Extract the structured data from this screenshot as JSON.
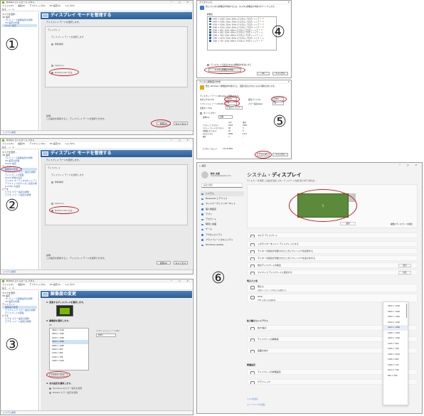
{
  "labels": {
    "one": "①",
    "two": "②",
    "three": "③",
    "four": "④",
    "five": "⑤",
    "six": "⑥"
  },
  "nvidia": {
    "window_title": "NVIDIA コントロール パネル",
    "menu": [
      "ファイル(F)",
      "編集(E)",
      "デスクトップ(K)",
      "3D 設定(3)",
      "ヘルプ(H)"
    ],
    "toolbar": [
      "戻る",
      "→",
      "⌂"
    ],
    "tree": [
      {
        "text": "タスクを選択...",
        "kind": "cat"
      },
      {
        "text": "3D 設定",
        "kind": "cat"
      },
      {
        "text": "プレビューで画像設定を調整",
        "kind": "item"
      },
      {
        "text": "3D 設定の管理",
        "kind": "item"
      },
      {
        "text": "PhysX 設定",
        "kind": "item"
      },
      {
        "text": "ディスプレイ",
        "kind": "cat"
      },
      {
        "text": "解像度の変更",
        "kind": "item"
      },
      {
        "text": "デスクトップ カラー設定の調整",
        "kind": "item"
      },
      {
        "text": "ディスプレイの回転",
        "kind": "item"
      },
      {
        "text": "HDCP 状態の表示",
        "kind": "item"
      },
      {
        "text": "デジタル オーディオのセットアップ",
        "kind": "item"
      },
      {
        "text": "デスクトップのサイズと位置の調整",
        "kind": "item"
      },
      {
        "text": "G-SYNC の設定",
        "kind": "item"
      },
      {
        "text": "ビデオ",
        "kind": "cat"
      },
      {
        "text": "ビデオ カラー設定の調整",
        "kind": "item"
      },
      {
        "text": "ビデオ イメージ設定の調整",
        "kind": "item"
      }
    ],
    "header_manage": "ディスプレイ モードを管理する",
    "header_resolution": "解像度の変更",
    "sub_manage": "ディスプレイ モードを選択します。",
    "group_title": "ディスプレイ",
    "opt_prompt": "ディスプレイ モードを選択します",
    "opt_a": "単体構成",
    "opt_b": "Optimus",
    "opt_c": "NVIDIA GPU のみ",
    "desc_label": "説明:",
    "desc_text": "この設定を使用すると、ディスプレイ モードを選択できます。",
    "apply": "適用(A)",
    "cancel": "キャンセル",
    "status": "システム情報",
    "res_step1": "1. 変更するディスプレイを選択します。",
    "res_step2": "2. 解像度を選択します。",
    "res_step3": "3. 次の設定を適用します。",
    "res_refresh_label": "リフレッシュ レート(R):",
    "res_refresh_value": "60Hz",
    "res_group": "PC",
    "res_values": [
      "3840 × 2160",
      "2560 × 1440",
      "1920 × 1200",
      "1920 × 1080",
      "1680 × 1050",
      "1600 × 900",
      "1440 × 900",
      "1366 × 768",
      "1280 × 1024"
    ],
    "res_custom": "カスタマイズ(C)...",
    "res_color_a": "Windows のカラー設定を使用",
    "res_color_b": "NVIDIA カラー設定を使用"
  },
  "dialog4": {
    "title": "カスタマイズ",
    "heading": "新しいカスタム解像度を作成するには、[カスタム解像度の作成] をクリックします。",
    "list_label": "解像度:",
    "rows": [
      "1920 × 1080, 32bit, 60Hz (カスタム) プログレッシブ",
      "1920 × 1080, 32bit, 59Hz (カスタム) プログレッシブ",
      "1920 × 1080, 32bit, 50Hz (カスタム) プログレッシブ",
      "1680 × 1050, 32bit, 60Hz (カスタム) プログレッシブ",
      "1600 × 900, 32bit, 60Hz (カスタム) プログレッシブ",
      "1440 × 900, 32bit, 60Hz (カスタム) プログレッシブ",
      "1366 × 768, 32bit, 60Hz (カスタム) プログレッシブ",
      "1280 × 1024, 32bit, 60Hz (カスタム) プログレッシブ",
      "1280 × 720, 32bit, 60Hz (カスタム) プログレッシブ"
    ],
    "enable_note": "ディスプレイで表示されない解像度を有効にする",
    "create_button": "カスタム解像度の作成...",
    "ok": "OK",
    "cancel": "キャンセル"
  },
  "dialog5": {
    "title": "カスタム解像度の作成",
    "warning": "警告: Windows で解像度を作成すると、画面が表示されなくなる可能性があります。",
    "display_mode": "ディスプレイ モード (Windows で報告される)",
    "h_pixels_label": "水平ピクセル(H):",
    "h_pixels": "1920",
    "v_lines_label": "垂直ライン(V):",
    "v_lines": "1080",
    "refresh_label": "リフレッシュ レート(Hz)(R):",
    "refresh": "75",
    "color_label": "カラー深度(bpp):",
    "color": "32",
    "scan_label": "走査タイプ(S):",
    "scan": "プログレッシブ",
    "timing": "タイミング(T)",
    "standard_label": "標準(S):",
    "standard": "自動",
    "table_head": [
      "",
      "水平",
      "垂直"
    ],
    "table_rows": [
      [
        "アクティブ ピクセル",
        "1920",
        "1080"
      ],
      [
        "フロント ポーチ (ピクセル)",
        "48",
        "3"
      ],
      [
        "同期幅 (ピクセル)",
        "32",
        "5"
      ],
      [
        "合計ピクセル",
        "2080",
        "1111"
      ],
      [
        "極性",
        "+",
        "-"
      ]
    ],
    "pixel_clock_label": "ピクセル クロック",
    "pixel_clock": "173.33 MHz",
    "test": "テスト(E)",
    "cancel": "キャンセル"
  },
  "settings": {
    "window_title": "設定",
    "user_name": "鈴木 太郎",
    "user_email": "suzuki@example.com",
    "search_placeholder": "設定の検索",
    "nav": [
      "システム",
      "Bluetooth とデバイス",
      "ネットワークとインターネット",
      "個人用設定",
      "アプリ",
      "アカウント",
      "時刻と言語",
      "ゲーム",
      "アクセシビリティ",
      "プライバシーとセキュリティ",
      "Windows Update"
    ],
    "breadcrumb_parent": "システム",
    "breadcrumb_sep": "›",
    "breadcrumb_current": "ディスプレイ",
    "intro": "ディスプレイを選択して設定を変更します。ディスプレイの並び替えを行う場合は...",
    "monitor_label": "1",
    "identify": "識別",
    "multi_display": "複数のディスプレイを検出",
    "rows_top": [
      "マルチ ディスプレイ",
      "このモニターをメイン ディスプレイにする",
      "モニターの接続が切断されたときにウィンドウを記憶する",
      "モニターの接続が切断されたときにウィンドウを最小化する",
      "他のディスプレイの検出",
      "ワイヤレス ディスプレイに接続する"
    ],
    "detect_btn": "検出",
    "connect_btn": "接続",
    "section_brightness": "明るさと色",
    "brightness_label": "明るさ",
    "brightness_sub": "内蔵ディスプレイの明るさを調整する",
    "hdr_label": "HDR",
    "hdr_sub": "HDR に関する詳細情報",
    "section_scale": "拡大縮小とレイアウト",
    "scale_label": "拡大/縮小",
    "resolution_label": "ディスプレイの解像度",
    "orientation_label": "画面の向き",
    "section_related": "関連設定",
    "advanced_label": "ディスプレイの詳細設定",
    "graphics_label": "グラフィック",
    "resolution_options": [
      "3840 × 2160",
      "2560 × 1600",
      "2560 × 1440",
      "1920 × 1200",
      "1920 × 1080",
      "1680 × 1050",
      "1600 × 1200",
      "1440 × 900",
      "1366 × 768",
      "1280 × 1024",
      "1280 × 800",
      "1280 × 720",
      "1024 × 768",
      "800 × 600"
    ],
    "help": "ヘルプを表示",
    "feedback": "フィードバックの送信",
    "accent": "#3b78d8",
    "monitor_color": "#5a8a3a"
  }
}
